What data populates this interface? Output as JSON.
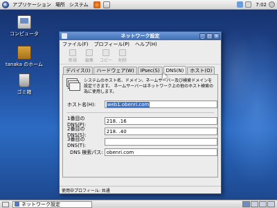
{
  "top_panel": {
    "menus": [
      "アプリケーション",
      "場所",
      "システム"
    ],
    "clock": "7:02"
  },
  "desktop_icons": [
    {
      "label": "コンピュータ",
      "icon": "computer-icon"
    },
    {
      "label": "tanaka のホーム",
      "icon": "home-folder-icon"
    },
    {
      "label": "ゴミ箱",
      "icon": "trash-icon"
    }
  ],
  "window": {
    "title": "ネットワーク設定",
    "menus": [
      "ファイル(F)",
      "プロフィール(P)",
      "ヘルプ(H)"
    ],
    "toolbar": [
      "新規",
      "編集",
      "コピー",
      "削除"
    ],
    "tabs": [
      "デバイス(I)",
      "ハードウェア(W)",
      "IPsec(S)",
      "DNS(N)",
      "ホスト(O)"
    ],
    "active_tab": "DNS(N)",
    "info_text": "システムのホスト名、ドメイン、ネームサーバー及び検索ドメインを設定できます。 ネームサーバーはネットワーク上の他のホスト検索の為に使用します。",
    "hostname_label": "ホスト名(H):",
    "hostname_value": "web1.obenri.com",
    "dns1_label": "1番目の DNS(P):",
    "dns1_value": "218.        .16",
    "dns2_label": "2番目の DNS(S):",
    "dns2_value": "218.        .40",
    "dns3_label": "3番目の DNS(T):",
    "dns3_value": "",
    "search_label": "DNS 検索パス:",
    "search_value": "obenri.com",
    "status": "使用中プロフィール: 共通"
  },
  "taskbar": {
    "task_label": "ネットワーク設定"
  },
  "colors": {
    "desktop": "#1f4a96",
    "titlebar": "#3e6db3",
    "selection": "#3f6fc0"
  }
}
